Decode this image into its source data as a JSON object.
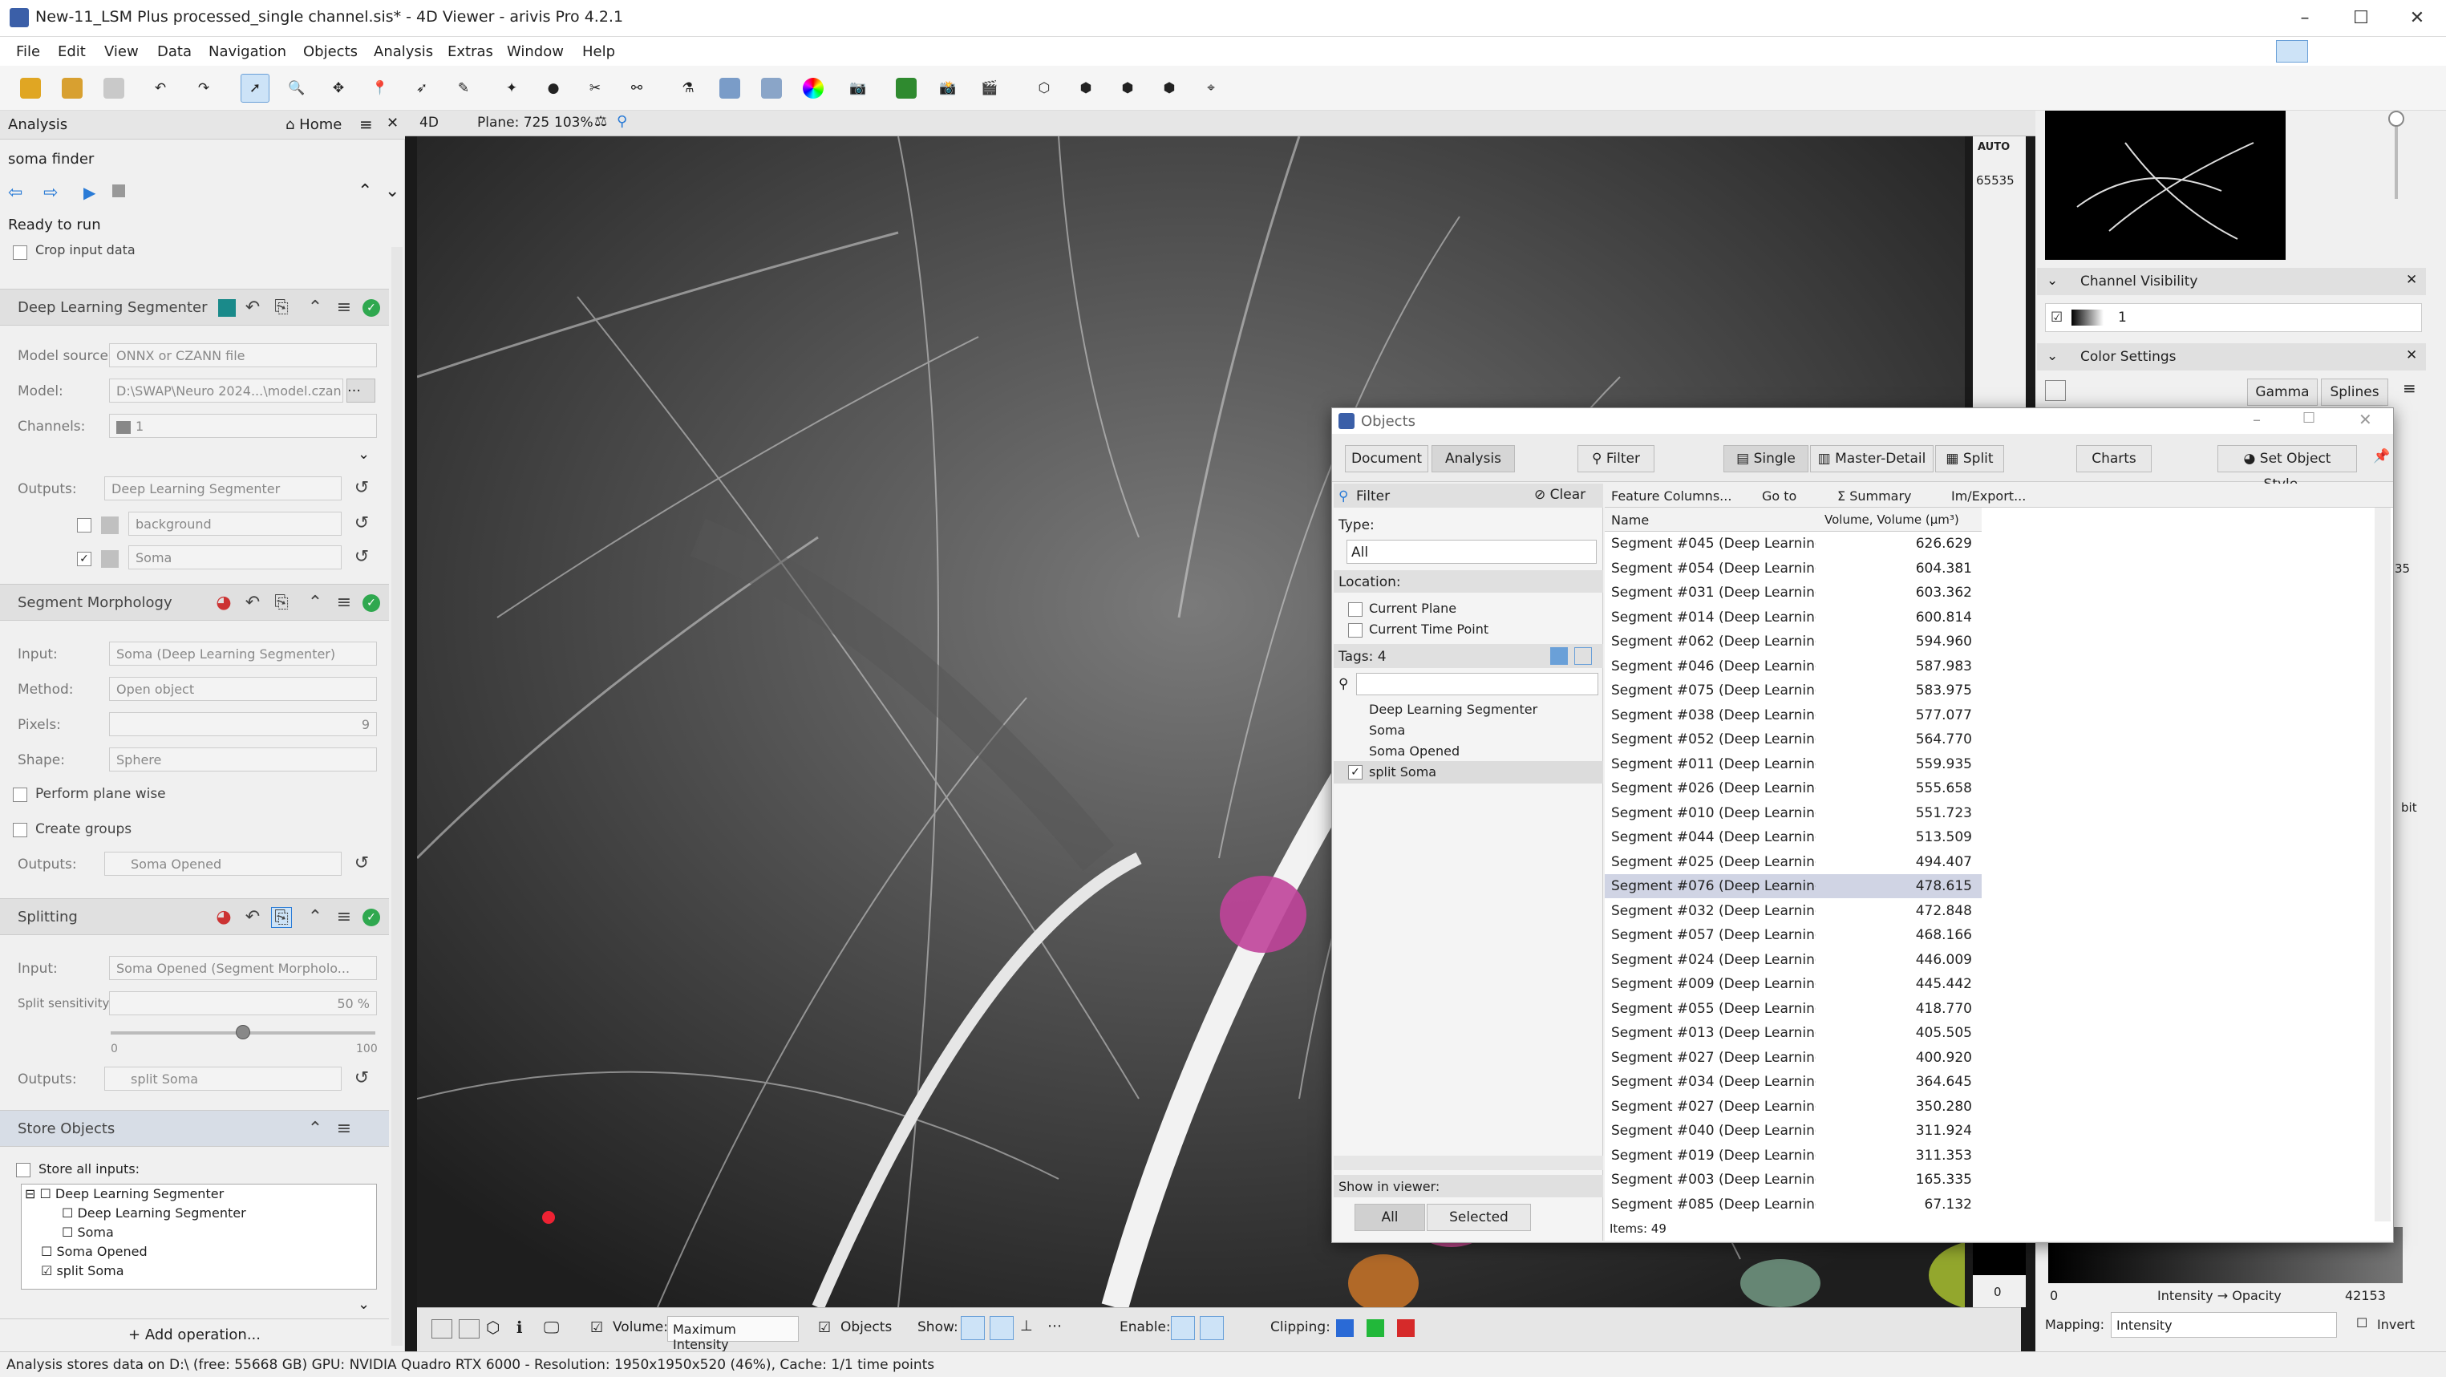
{
  "window": {
    "title": "New-11_LSM Plus processed_single channel.sis* - 4D Viewer - arivis Pro 4.2.1"
  },
  "menu": [
    "File",
    "Edit",
    "View",
    "Data",
    "Navigation",
    "Objects",
    "Analysis",
    "Extras",
    "Window",
    "Help"
  ],
  "analysis_panel": {
    "title": "Analysis",
    "home": "Home",
    "pipeline_name": "soma finder",
    "status": "Ready to run",
    "crop_label": "Crop input data",
    "dls": {
      "title": "Deep Learning Segmenter",
      "model_source_label": "Model source:",
      "model_source": "ONNX or CZANN file",
      "model_label": "Model:",
      "model": "D:\\SWAP\\Neuro 2024...\\model.czann",
      "channels_label": "Channels:",
      "channels": "1",
      "outputs_label": "Outputs:",
      "outputs": "Deep Learning Segmenter",
      "out1": "background",
      "out2": "Soma"
    },
    "morph": {
      "title": "Segment Morphology",
      "input_label": "Input:",
      "input": "Soma (Deep Learning Segmenter)",
      "method_label": "Method:",
      "method": "Open object",
      "pixels_label": "Pixels:",
      "pixels": "9",
      "shape_label": "Shape:",
      "shape": "Sphere",
      "plane_wise": "Perform plane wise",
      "groups": "Create groups",
      "outputs_label": "Outputs:",
      "outputs": "Soma Opened"
    },
    "split": {
      "title": "Splitting",
      "input_label": "Input:",
      "input": "Soma Opened (Segment Morpholo...",
      "sens_label": "Split sensitivity:",
      "sens": "50 %",
      "min": "0",
      "max": "100",
      "sens_value": 0.5,
      "outputs_label": "Outputs:",
      "outputs": "split Soma"
    },
    "store": {
      "title": "Store Objects",
      "all": "Store all inputs:",
      "tree": [
        "Deep Learning Segmenter",
        "Deep Learning Segmenter",
        "Soma",
        "Soma Opened",
        "split Soma"
      ]
    },
    "add": "+ Add operation..."
  },
  "viewer": {
    "mode": "4D",
    "plane": "Plane: 725",
    "zoom": "103%",
    "auto": "AUTO",
    "max": "65535",
    "min": "0"
  },
  "objects": {
    "title": "Objects",
    "tabs": [
      "Document",
      "Analysis"
    ],
    "filter_btn": "Filter",
    "views": [
      "Single",
      "Master-Detail",
      "Split"
    ],
    "charts": "Charts",
    "style": "Set Object Style...",
    "filter": {
      "title": "Filter",
      "clear": "Clear",
      "type_label": "Type:",
      "type": "All",
      "location_label": "Location:",
      "current_plane": "Current Plane",
      "current_time": "Current Time Point",
      "tags_label": "Tags: 4",
      "tags": [
        "Deep Learning Segmenter",
        "Soma",
        "Soma Opened",
        "split Soma"
      ],
      "show_label": "Show in viewer:",
      "show_all": "All",
      "show_selected": "Selected"
    },
    "table_toolbar": [
      "Feature Columns...",
      "Go to",
      "Σ Summary",
      "Im/Export..."
    ],
    "columns": [
      "Name",
      "Volume, Volume (µm³)"
    ],
    "rows": [
      [
        "Segment #045 (Deep Learning ...",
        "626.629"
      ],
      [
        "Segment #054 (Deep Learning ...",
        "604.381"
      ],
      [
        "Segment #031 (Deep Learning ...",
        "603.362"
      ],
      [
        "Segment #014 (Deep Learning ...",
        "600.814"
      ],
      [
        "Segment #062 (Deep Learning ...",
        "594.960"
      ],
      [
        "Segment #046 (Deep Learning ...",
        "587.983"
      ],
      [
        "Segment #075 (Deep Learning ...",
        "583.975"
      ],
      [
        "Segment #038 (Deep Learning ...",
        "577.077"
      ],
      [
        "Segment #052 (Deep Learning ...",
        "564.770"
      ],
      [
        "Segment #011 (Deep Learning ...",
        "559.935"
      ],
      [
        "Segment #026 (Deep Learning ...",
        "555.658"
      ],
      [
        "Segment #010 (Deep Learning ...",
        "551.723"
      ],
      [
        "Segment #044 (Deep Learning ...",
        "513.509"
      ],
      [
        "Segment #025 (Deep Learning ...",
        "494.407"
      ],
      [
        "Segment #076 (Deep Learning ...",
        "478.615"
      ],
      [
        "Segment #032 (Deep Learning ...",
        "472.848"
      ],
      [
        "Segment #057 (Deep Learning ...",
        "468.166"
      ],
      [
        "Segment #024 (Deep Learning ...",
        "446.009"
      ],
      [
        "Segment #009 (Deep Learning ...",
        "445.442"
      ],
      [
        "Segment #055 (Deep Learning ...",
        "418.770"
      ],
      [
        "Segment #013 (Deep Learning ...",
        "405.505"
      ],
      [
        "Segment #027 (Deep Learning ...",
        "400.920"
      ],
      [
        "Segment #034 (Deep Learning ...",
        "364.645"
      ],
      [
        "Segment #027 (Deep Learning ...",
        "350.280"
      ],
      [
        "Segment #040 (Deep Learning ...",
        "311.924"
      ],
      [
        "Segment #019 (Deep Learning ...",
        "311.353"
      ],
      [
        "Segment #003 (Deep Learning ...",
        "165.335"
      ],
      [
        "Segment #085 (Deep Learning ...",
        "67.132"
      ]
    ],
    "items": "Items: 49"
  },
  "right_panel": {
    "channel_vis": "Channel Visibility",
    "channel": "1",
    "color_settings": "Color Settings",
    "gamma": "Gamma",
    "splines": "Splines",
    "lut_min": "0",
    "lut_label": "Intensity → Opacity",
    "lut_max": "42153",
    "mapping_label": "Mapping:",
    "mapping": "Intensity",
    "invert": "Invert",
    "edge_35": "35",
    "edge_bit": "bit"
  },
  "bottom": {
    "volume_label": "Volume:",
    "volume_mode": "Maximum Intensity",
    "objects": "Objects",
    "show": "Show:",
    "enable": "Enable:",
    "clipping": "Clipping:"
  },
  "status": "Analysis stores data on D:\\ (free: 55668 GB)  GPU: NVIDIA Quadro RTX 6000  - Resolution: 1950x1950x520 (46%), Cache: 1/1 time points"
}
